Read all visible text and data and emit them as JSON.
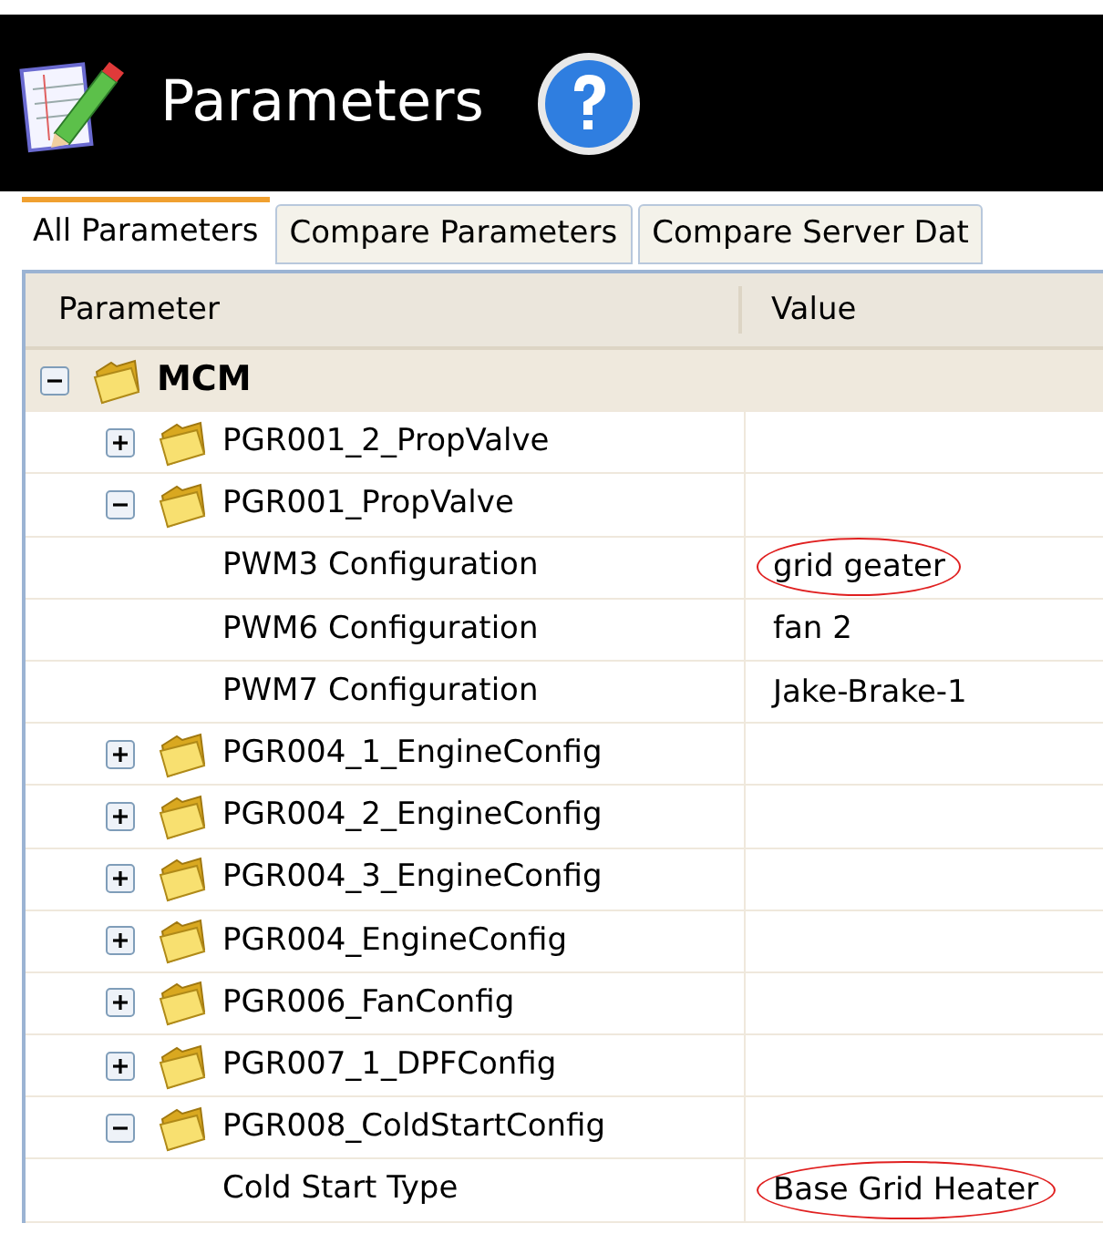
{
  "header": {
    "title": "Parameters"
  },
  "tabs": [
    {
      "label": "All Parameters",
      "selected": true
    },
    {
      "label": "Compare Parameters",
      "selected": false
    },
    {
      "label": "Compare Server Dat",
      "selected": false
    }
  ],
  "table": {
    "columns": [
      "Parameter",
      "Value"
    ],
    "tree": [
      {
        "kind": "group",
        "label": "MCM",
        "expanded": true,
        "children": [
          {
            "kind": "group",
            "label": "PGR001_2_PropValve",
            "expanded": false
          },
          {
            "kind": "group",
            "label": "PGR001_PropValve",
            "expanded": true,
            "children": [
              {
                "kind": "parameter",
                "label": "PWM3 Configuration",
                "value": "grid geater",
                "circled": true
              },
              {
                "kind": "parameter",
                "label": "PWM6 Configuration",
                "value": "fan 2",
                "circled": false
              },
              {
                "kind": "parameter",
                "label": "PWM7 Configuration",
                "value": "Jake-Brake-1",
                "circled": false
              }
            ]
          },
          {
            "kind": "group",
            "label": "PGR004_1_EngineConfig",
            "expanded": false
          },
          {
            "kind": "group",
            "label": "PGR004_2_EngineConfig",
            "expanded": false
          },
          {
            "kind": "group",
            "label": "PGR004_3_EngineConfig",
            "expanded": false
          },
          {
            "kind": "group",
            "label": "PGR004_EngineConfig",
            "expanded": false
          },
          {
            "kind": "group",
            "label": "PGR006_FanConfig",
            "expanded": false
          },
          {
            "kind": "group",
            "label": "PGR007_1_DPFConfig",
            "expanded": false
          },
          {
            "kind": "group",
            "label": "PGR008_ColdStartConfig",
            "expanded": true,
            "children": [
              {
                "kind": "parameter",
                "label": "Cold Start Type",
                "value": "Base Grid Heater",
                "circled": true
              }
            ]
          }
        ]
      }
    ]
  }
}
